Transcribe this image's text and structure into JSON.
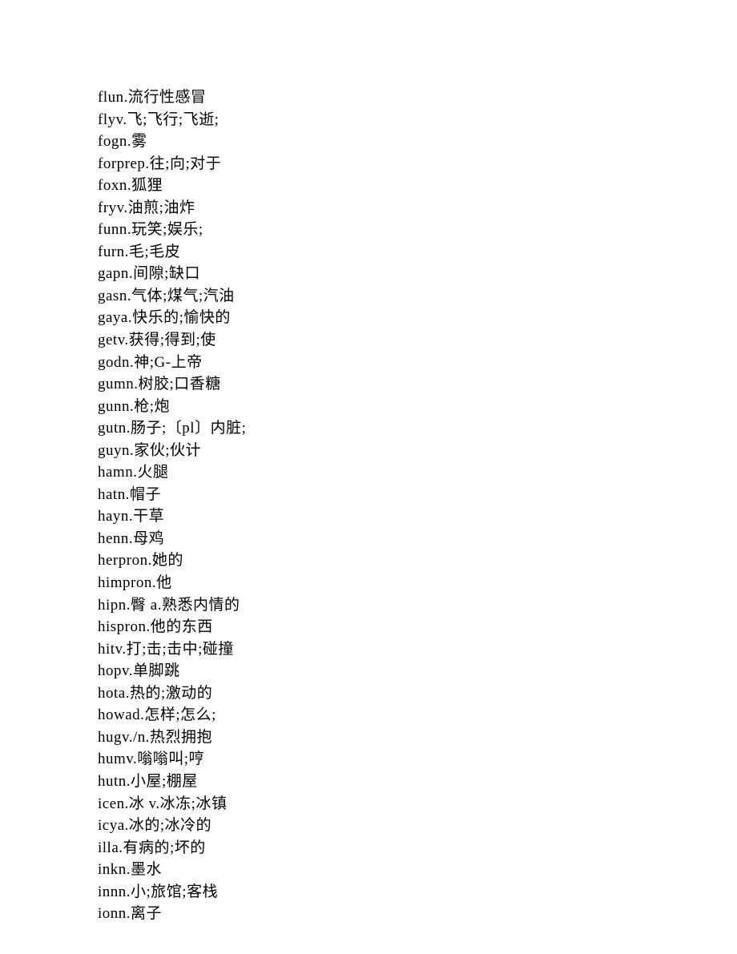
{
  "entries": [
    "flun.流行性感冒",
    "flyv.飞;飞行;飞逝;",
    "fogn.雾",
    "forprep.往;向;对于",
    "foxn.狐狸",
    "fryv.油煎;油炸",
    "funn.玩笑;娱乐;",
    "furn.毛;毛皮",
    "gapn.间隙;缺口",
    "gasn.气体;煤气;汽油",
    "gaya.快乐的;愉快的",
    "getv.获得;得到;使",
    "godn.神;G-上帝",
    "gumn.树胶;口香糖",
    "gunn.枪;炮",
    "gutn.肠子;〔pl〕内脏;",
    "guyn.家伙;伙计",
    "hamn.火腿",
    "hatn.帽子",
    "hayn.干草",
    "henn.母鸡",
    "herpron.她的",
    "himpron.他",
    "hipn.臀 a.熟悉内情的",
    "hispron.他的东西",
    "hitv.打;击;击中;碰撞",
    "hopv.单脚跳",
    "hota.热的;激动的",
    "howad.怎样;怎么;",
    "hugv./n.热烈拥抱",
    "humv.嗡嗡叫;哼",
    "hutn.小屋;棚屋",
    "icen.冰 v.冰冻;冰镇",
    "icya.冰的;冰冷的",
    "illa.有病的;坏的",
    "inkn.墨水",
    "innn.小;旅馆;客栈",
    "ionn.离子"
  ]
}
